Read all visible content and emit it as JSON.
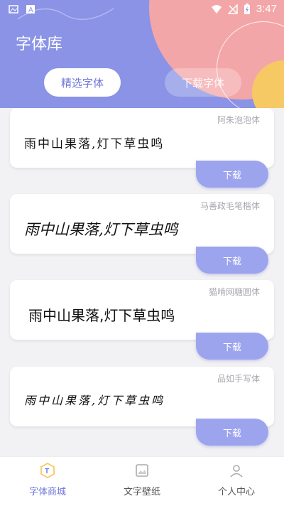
{
  "status_bar": {
    "time": "3:47"
  },
  "header": {
    "title": "字体库"
  },
  "tabs": [
    {
      "label": "精选字体",
      "active": true
    },
    {
      "label": "下载字体",
      "active": false
    }
  ],
  "fonts": [
    {
      "name": "阿朱泡泡体",
      "preview": "雨中山果落,灯下草虫鸣",
      "button": "下载"
    },
    {
      "name": "马善政毛笔楷体",
      "preview": "雨中山果落,灯下草虫鸣",
      "button": "下载"
    },
    {
      "name": "猫啃网糖圆体",
      "preview": "雨中山果落,灯下草虫鸣",
      "button": "下载"
    },
    {
      "name": "品如手写体",
      "preview": "雨中山果落,灯下草虫鸣",
      "button": "下载"
    }
  ],
  "bottom_nav": [
    {
      "label": "字体商城",
      "icon": "font-store-icon",
      "active": true
    },
    {
      "label": "文字壁纸",
      "icon": "wallpaper-icon",
      "active": false
    },
    {
      "label": "个人中心",
      "icon": "profile-icon",
      "active": false
    }
  ],
  "colors": {
    "accent": "#8a93e6",
    "pink": "#f3a6a8",
    "yellow": "#f6c965",
    "button": "#9da4ee"
  }
}
